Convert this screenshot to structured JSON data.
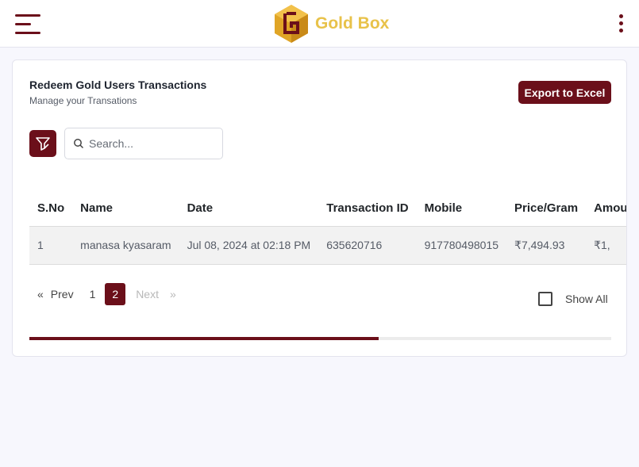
{
  "header": {
    "brand": "Gold Box",
    "brand_color": "#e8c24a",
    "accent_color": "#6b0f1a",
    "menu_icon": "hamburger-icon",
    "more_icon": "kebab-menu-icon",
    "logo_icon": "gold-box-logo-icon"
  },
  "card": {
    "title": "Redeem Gold Users Transactions",
    "subtitle": "Manage your Transations",
    "export_label": "Export to Excel",
    "filter_icon": "filter-icon",
    "search": {
      "placeholder": "Search...",
      "value": "",
      "icon": "search-icon"
    }
  },
  "table": {
    "columns": [
      "S.No",
      "Name",
      "Date",
      "Transaction ID",
      "Mobile",
      "Price/Gram",
      "Amount"
    ],
    "rows": [
      [
        "1",
        "manasa kyasaram",
        "Jul 08, 2024 at 02:18 PM",
        "635620716",
        "917780498015",
        "₹7,494.93",
        "₹1,"
      ]
    ]
  },
  "pagination": {
    "prev_arrow": "«",
    "prev_label": "Prev",
    "pages": [
      "1",
      "2"
    ],
    "current_page": "2",
    "next_label": "Next",
    "next_arrow": "»"
  },
  "show_all": {
    "label": "Show All",
    "checked": false
  },
  "horizontal_scroll": {
    "position_fraction": 0.0,
    "visible_fraction": 0.6
  }
}
